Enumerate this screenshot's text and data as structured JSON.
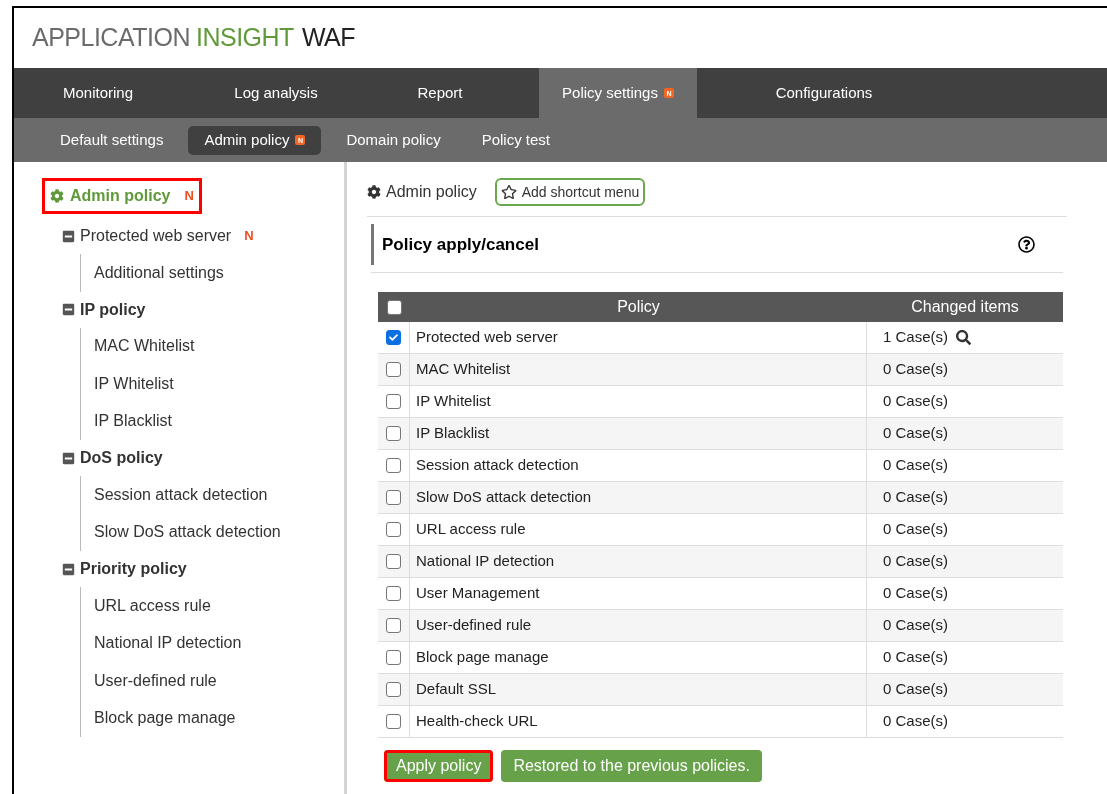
{
  "logo": {
    "part_1": "APPLICATION",
    "part_2": "INSIGHT",
    "part_3": "WAF"
  },
  "main_nav": [
    {
      "label": "Monitoring",
      "selected": false
    },
    {
      "label": "Log analysis",
      "selected": false
    },
    {
      "label": "Report",
      "selected": false
    },
    {
      "label": "Policy settings",
      "selected": true,
      "badge": "N"
    },
    {
      "label": "Configurations",
      "selected": false
    }
  ],
  "sub_nav": [
    {
      "label": "Default settings",
      "selected": false
    },
    {
      "label": "Admin policy",
      "selected": true,
      "badge": "N"
    },
    {
      "label": "Domain policy",
      "selected": false
    },
    {
      "label": "Policy test",
      "selected": false
    }
  ],
  "sidebar": {
    "title": "Admin policy",
    "title_badge": "N",
    "highlighted": true,
    "groups": [
      {
        "label": "Protected web server",
        "bold": false,
        "badge": "N",
        "children": [
          {
            "label": "Additional settings"
          }
        ]
      },
      {
        "label": "IP policy",
        "bold": true,
        "children": [
          {
            "label": "MAC Whitelist"
          },
          {
            "label": "IP Whitelist"
          },
          {
            "label": "IP Blacklist"
          }
        ]
      },
      {
        "label": "DoS policy",
        "bold": true,
        "children": [
          {
            "label": "Session attack detection"
          },
          {
            "label": "Slow DoS attack detection"
          }
        ]
      },
      {
        "label": "Priority policy",
        "bold": true,
        "children": [
          {
            "label": "URL access rule"
          },
          {
            "label": "National IP detection"
          },
          {
            "label": "User-defined rule"
          },
          {
            "label": "Block page manage"
          }
        ]
      }
    ]
  },
  "breadcrumb": "Admin policy",
  "shortcut_button": "Add shortcut menu",
  "section_title": "Policy apply/cancel",
  "table": {
    "all_checked": false,
    "columns": [
      "Policy",
      "Changed items"
    ],
    "rows": [
      {
        "checked": true,
        "policy": "Protected web server",
        "changed": "1 Case(s)",
        "detail": true
      },
      {
        "checked": false,
        "policy": "MAC Whitelist",
        "changed": "0 Case(s)",
        "detail": false
      },
      {
        "checked": false,
        "policy": "IP Whitelist",
        "changed": "0 Case(s)",
        "detail": false
      },
      {
        "checked": false,
        "policy": "IP Blacklist",
        "changed": "0 Case(s)",
        "detail": false
      },
      {
        "checked": false,
        "policy": "Session attack detection",
        "changed": "0 Case(s)",
        "detail": false
      },
      {
        "checked": false,
        "policy": "Slow DoS attack detection",
        "changed": "0 Case(s)",
        "detail": false
      },
      {
        "checked": false,
        "policy": "URL access rule",
        "changed": "0 Case(s)",
        "detail": false
      },
      {
        "checked": false,
        "policy": "National IP detection",
        "changed": "0 Case(s)",
        "detail": false
      },
      {
        "checked": false,
        "policy": "User Management",
        "changed": "0 Case(s)",
        "detail": false
      },
      {
        "checked": false,
        "policy": "User-defined rule",
        "changed": "0 Case(s)",
        "detail": false
      },
      {
        "checked": false,
        "policy": "Block page manage",
        "changed": "0 Case(s)",
        "detail": false
      },
      {
        "checked": false,
        "policy": "Default SSL",
        "changed": "0 Case(s)",
        "detail": false
      },
      {
        "checked": false,
        "policy": "Health-check URL",
        "changed": "0 Case(s)",
        "detail": false
      }
    ]
  },
  "buttons": [
    {
      "label": "Apply policy",
      "highlighted": true
    },
    {
      "label": "Restored to the previous policies.",
      "highlighted": false
    }
  ]
}
